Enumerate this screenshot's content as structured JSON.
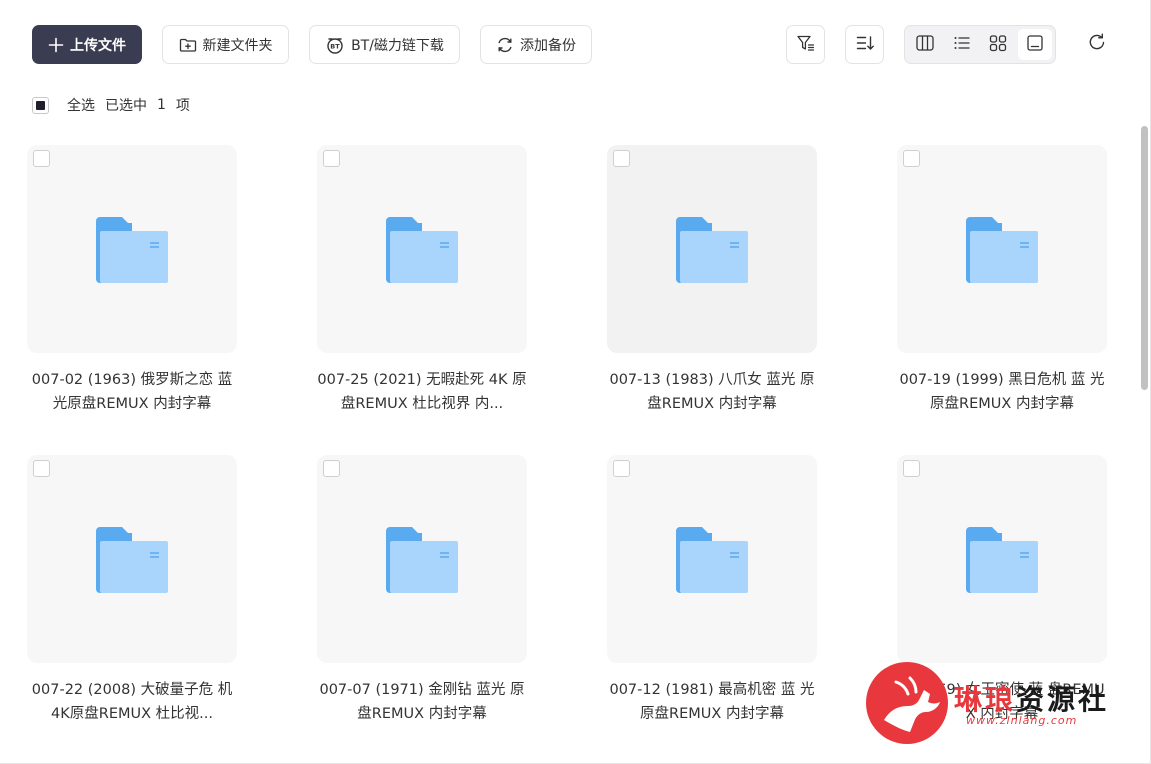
{
  "toolbar": {
    "upload_label": "上传文件",
    "new_folder_label": "新建文件夹",
    "bt_label": "BT/磁力链下载",
    "bt_icon_text": "BT",
    "backup_label": "添加备份"
  },
  "selection": {
    "select_all_label": "全选",
    "selected_prefix": "已选中",
    "selected_count": "1",
    "selected_suffix": "项"
  },
  "files": [
    {
      "name": "007-02 (1963) 俄罗斯之恋 蓝光原盘REMUX 内封字幕"
    },
    {
      "name": "007-25 (2021) 无暇赴死 4K 原盘REMUX 杜比视界 内..."
    },
    {
      "name": "007-13 (1983) 八爪女 蓝光 原盘REMUX 内封字幕"
    },
    {
      "name": "007-19 (1999) 黑日危机 蓝 光原盘REMUX 内封字幕"
    },
    {
      "name": "007-22 (2008) 大破量子危 机 4K原盘REMUX 杜比视..."
    },
    {
      "name": "007-07 (1971) 金刚钻 蓝光 原盘REMUX 内封字幕"
    },
    {
      "name": "007-12 (1981) 最高机密 蓝 光原盘REMUX 内封字幕"
    },
    {
      "name": "5 (1969) 女王密使 蓝 盘REMUX 内封字幕"
    }
  ],
  "watermark": {
    "text_red": "琳琅",
    "text_dark": "资源社",
    "url": "www.zlnlang.com"
  },
  "colors": {
    "primary": "#3a3d52",
    "folder_blue": "#5aaaf0",
    "folder_light": "#a9d4fb",
    "watermark_red": "#e8383d"
  },
  "icons": {
    "upload": "plus-icon",
    "new_folder": "folder-plus-icon",
    "bt": "bt-icon",
    "backup": "sync-icon",
    "filter": "filter-icon",
    "sort": "sort-icon",
    "view_column": "column-view-icon",
    "view_list": "list-view-icon",
    "view_grid": "grid-view-icon",
    "view_large": "large-view-icon",
    "refresh": "refresh-icon"
  }
}
